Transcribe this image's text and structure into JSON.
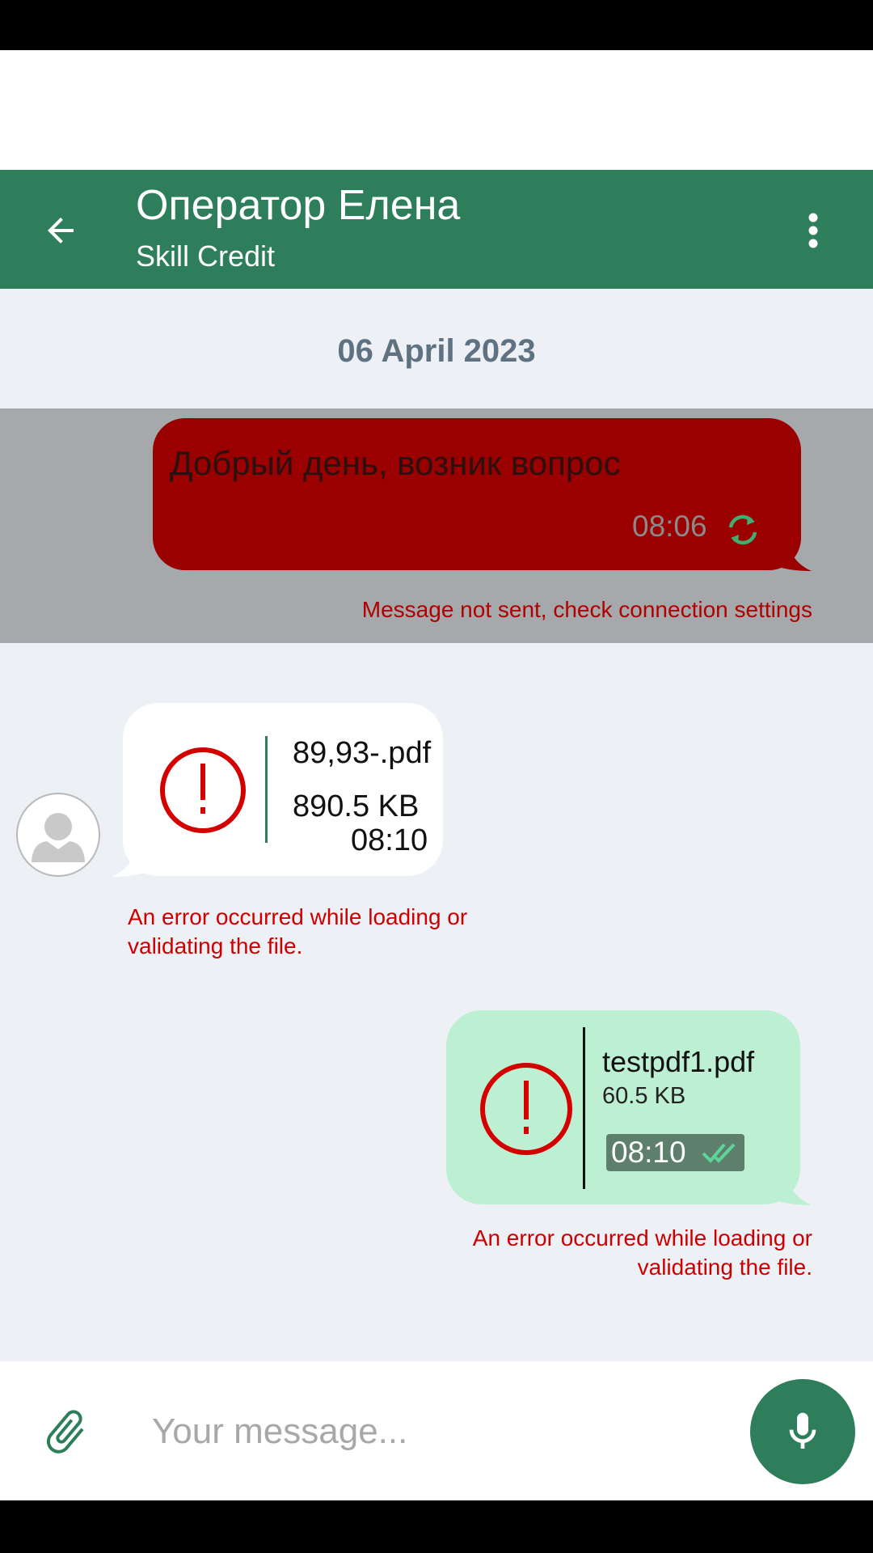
{
  "header": {
    "title": "Оператор Елена",
    "subtitle": "Skill Credit",
    "back_icon": "arrow-left-icon",
    "menu_icon": "more-vert-icon",
    "color": "#2e7d5b"
  },
  "date_separator": "06 April 2023",
  "messages": [
    {
      "direction": "outgoing",
      "text": "Добрый день, возник вопрос",
      "time": "08:06",
      "status_icon": "retry-icon",
      "error": "Message not sent, check connection settings",
      "bubble_color": "#9b0000"
    },
    {
      "direction": "incoming",
      "file_name": "89,93-.pdf",
      "file_size": "890.5 KB",
      "time": "08:10",
      "status_icon": "error-icon",
      "error": "An error occurred while loading or validating the file."
    },
    {
      "direction": "outgoing",
      "file_name": "testpdf1.pdf",
      "file_size": "60.5 KB",
      "time": "08:10",
      "status_icon": "double-check-icon",
      "error": "An error occurred while loading or validating the file.",
      "bubble_color": "#bdf0d2"
    }
  ],
  "composer": {
    "placeholder": "Your message...",
    "value": "",
    "attach_icon": "paperclip-icon",
    "mic_icon": "microphone-icon"
  }
}
